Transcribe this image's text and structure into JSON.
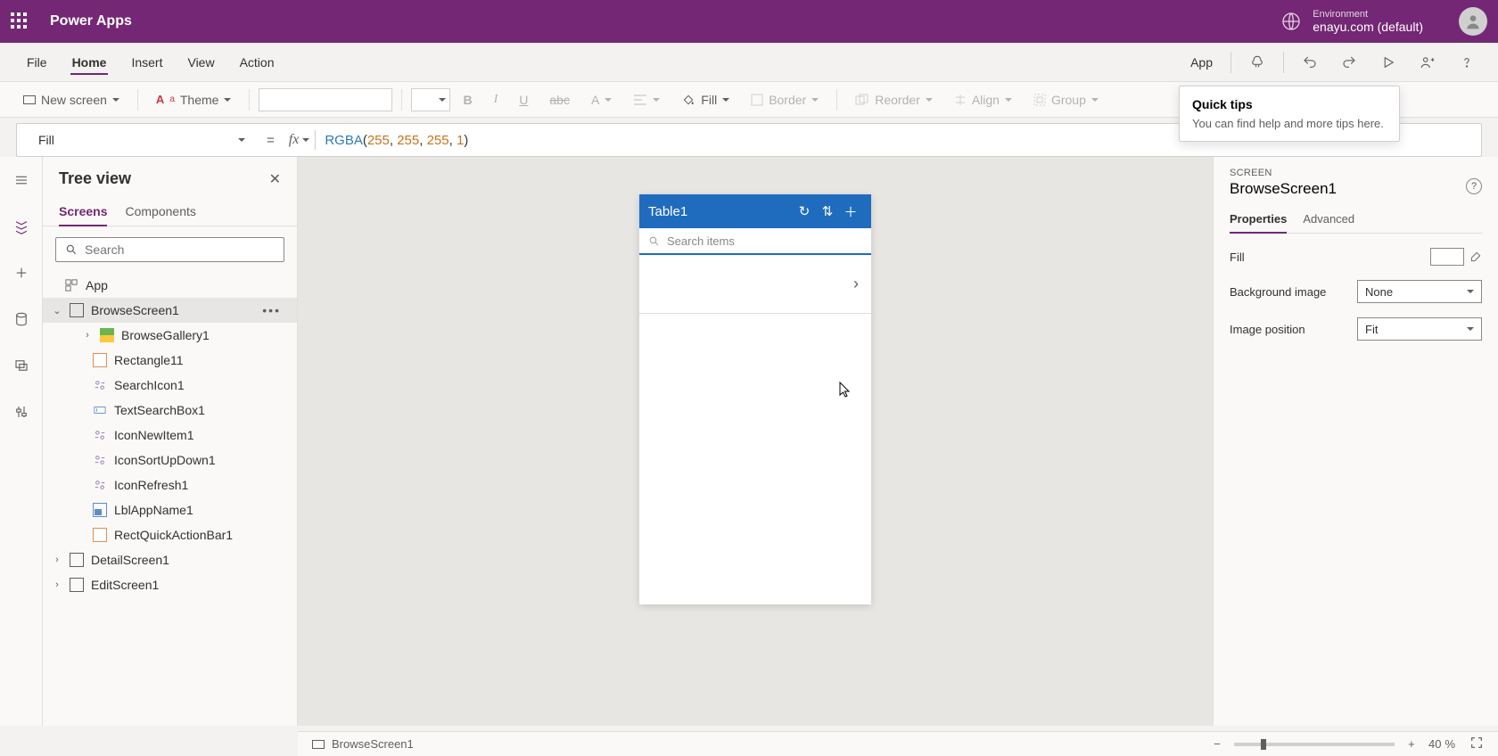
{
  "header": {
    "appTitle": "Power Apps",
    "envLabel": "Environment",
    "envName": "enayu.com (default)"
  },
  "menu": {
    "items": [
      "File",
      "Home",
      "Insert",
      "View",
      "Action"
    ],
    "activeIndex": 1,
    "appLabel": "App"
  },
  "ribbon": {
    "newScreen": "New screen",
    "theme": "Theme",
    "fill": "Fill",
    "border": "Border",
    "reorder": "Reorder",
    "align": "Align",
    "group": "Group"
  },
  "formula": {
    "property": "Fill",
    "fn": "RGBA",
    "args": [
      "255",
      "255",
      "255",
      "1"
    ]
  },
  "tree": {
    "title": "Tree view",
    "tabs": [
      "Screens",
      "Components"
    ],
    "searchPlaceholder": "Search",
    "items": {
      "app": "App",
      "browseScreen": "BrowseScreen1",
      "browseGallery": "BrowseGallery1",
      "rectangle": "Rectangle11",
      "searchIcon": "SearchIcon1",
      "textSearchBox": "TextSearchBox1",
      "iconNewItem": "IconNewItem1",
      "iconSortUpDown": "IconSortUpDown1",
      "iconRefresh": "IconRefresh1",
      "lblAppName": "LblAppName1",
      "rectQuickActionBar": "RectQuickActionBar1",
      "detailScreen": "DetailScreen1",
      "editScreen": "EditScreen1"
    }
  },
  "canvas": {
    "title": "Table1",
    "searchPlaceholder": "Search items"
  },
  "props": {
    "sectionLabel": "SCREEN",
    "title": "BrowseScreen1",
    "tabs": [
      "Properties",
      "Advanced"
    ],
    "fillLabel": "Fill",
    "bgImageLabel": "Background image",
    "bgImageValue": "None",
    "imgPosLabel": "Image position",
    "imgPosValue": "Fit"
  },
  "quickTip": {
    "title": "Quick tips",
    "body": "You can find help and more tips here."
  },
  "status": {
    "screenName": "BrowseScreen1",
    "zoom": "40",
    "pct": "%"
  }
}
